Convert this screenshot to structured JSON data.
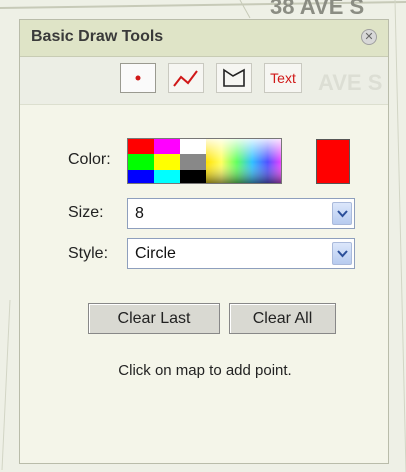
{
  "panel": {
    "title": "Basic Draw Tools",
    "close_icon": "close-icon"
  },
  "toolbar": {
    "tools": [
      {
        "name": "point",
        "icon": "point-icon",
        "active": true
      },
      {
        "name": "line",
        "icon": "polyline-icon",
        "active": false
      },
      {
        "name": "polygon",
        "icon": "polygon-icon",
        "active": false
      },
      {
        "name": "text",
        "label": "Text",
        "active": false
      }
    ]
  },
  "color": {
    "label": "Color:",
    "selected": "#ff0000"
  },
  "size": {
    "label": "Size:",
    "value": "8"
  },
  "style": {
    "label": "Style:",
    "value": "Circle"
  },
  "buttons": {
    "clear_last": "Clear Last",
    "clear_all": "Clear All"
  },
  "hint": "Click on map to add point.",
  "map": {
    "street_top": "38 AVE S",
    "street_right": "AVE S"
  }
}
